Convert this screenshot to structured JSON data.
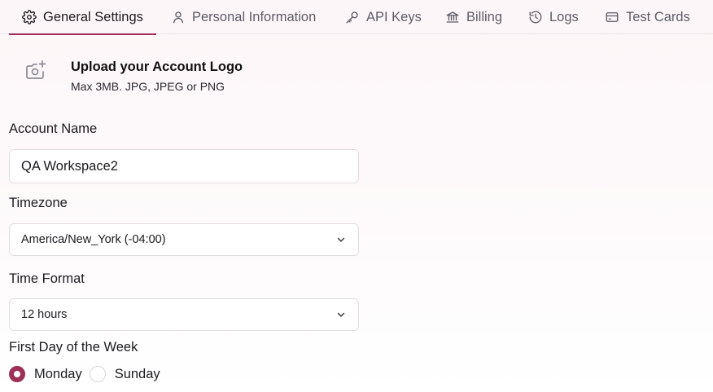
{
  "tabs": [
    {
      "label": "General Settings",
      "icon": "gear-icon",
      "active": true
    },
    {
      "label": "Personal Information",
      "icon": "user-icon",
      "active": false
    },
    {
      "label": "API Keys",
      "icon": "key-icon",
      "active": false
    },
    {
      "label": "Billing",
      "icon": "bank-icon",
      "active": false
    },
    {
      "label": "Logs",
      "icon": "history-icon",
      "active": false
    },
    {
      "label": "Test Cards",
      "icon": "credit-card-icon",
      "active": false
    }
  ],
  "upload": {
    "title": "Upload your Account Logo",
    "subtitle": "Max 3MB. JPG, JPEG or PNG",
    "icon": "camera-plus-icon"
  },
  "form": {
    "account_name_label": "Account Name",
    "account_name_value": "QA Workspace2",
    "timezone_label": "Timezone",
    "timezone_value": "America/New_York (-04:00)",
    "time_format_label": "Time Format",
    "time_format_value": "12 hours",
    "first_day_label": "First Day of the Week",
    "first_day_options": [
      {
        "label": "Monday",
        "checked": true
      },
      {
        "label": "Sunday",
        "checked": false
      }
    ]
  },
  "colors": {
    "accent": "#9e3057",
    "tab_underline": "#a0305a",
    "border": "#e3dce0"
  }
}
